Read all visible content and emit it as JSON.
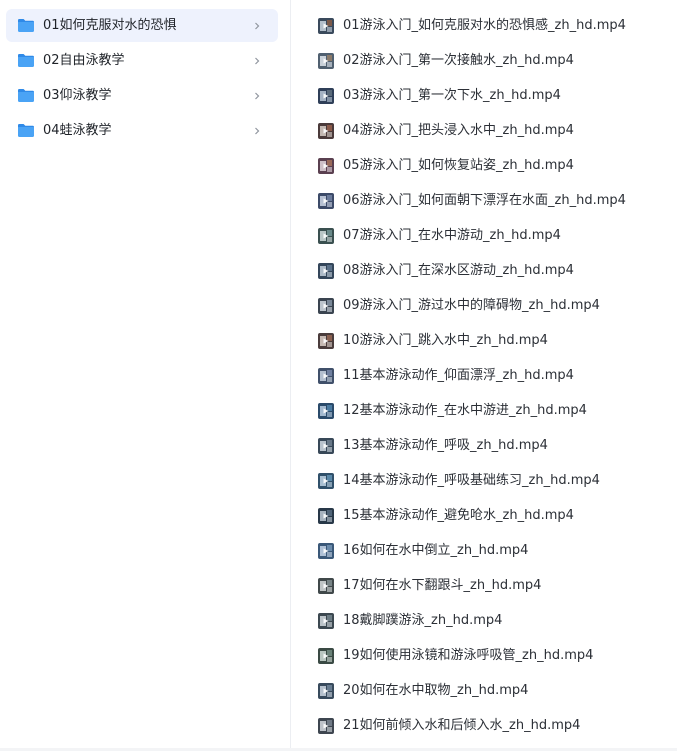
{
  "folders": [
    {
      "label": "01如何克服对水的恐惧",
      "icon": "folder-icon",
      "selected": true
    },
    {
      "label": "02自由泳教学",
      "icon": "folder-icon",
      "selected": false
    },
    {
      "label": "03仰泳教学",
      "icon": "folder-icon",
      "selected": false
    },
    {
      "label": "04蛙泳教学",
      "icon": "folder-icon",
      "selected": false
    }
  ],
  "files": [
    {
      "label": "01游泳入门_如何克服对水的恐惧感_zh_hd.mp4",
      "icon": "video-thumbnail-icon"
    },
    {
      "label": "02游泳入门_第一次接触水_zh_hd.mp4",
      "icon": "video-thumbnail-icon"
    },
    {
      "label": "03游泳入门_第一次下水_zh_hd.mp4",
      "icon": "video-thumbnail-icon"
    },
    {
      "label": "04游泳入门_把头浸入水中_zh_hd.mp4",
      "icon": "video-thumbnail-icon"
    },
    {
      "label": "05游泳入门_如何恢复站姿_zh_hd.mp4",
      "icon": "video-thumbnail-icon"
    },
    {
      "label": "06游泳入门_如何面朝下漂浮在水面_zh_hd.mp4",
      "icon": "video-thumbnail-icon"
    },
    {
      "label": "07游泳入门_在水中游动_zh_hd.mp4",
      "icon": "video-thumbnail-icon"
    },
    {
      "label": "08游泳入门_在深水区游动_zh_hd.mp4",
      "icon": "video-thumbnail-icon"
    },
    {
      "label": "09游泳入门_游过水中的障碍物_zh_hd.mp4",
      "icon": "video-thumbnail-icon"
    },
    {
      "label": "10游泳入门_跳入水中_zh_hd.mp4",
      "icon": "video-thumbnail-icon"
    },
    {
      "label": "11基本游泳动作_仰面漂浮_zh_hd.mp4",
      "icon": "video-thumbnail-icon"
    },
    {
      "label": "12基本游泳动作_在水中游进_zh_hd.mp4",
      "icon": "video-thumbnail-icon"
    },
    {
      "label": "13基本游泳动作_呼吸_zh_hd.mp4",
      "icon": "video-thumbnail-icon"
    },
    {
      "label": "14基本游泳动作_呼吸基础练习_zh_hd.mp4",
      "icon": "video-thumbnail-icon"
    },
    {
      "label": "15基本游泳动作_避免呛水_zh_hd.mp4",
      "icon": "video-thumbnail-icon"
    },
    {
      "label": "16如何在水中倒立_zh_hd.mp4",
      "icon": "video-thumbnail-icon"
    },
    {
      "label": "17如何在水下翻跟斗_zh_hd.mp4",
      "icon": "video-thumbnail-icon"
    },
    {
      "label": "18戴脚蹼游泳_zh_hd.mp4",
      "icon": "video-thumbnail-icon"
    },
    {
      "label": "19如何使用泳镜和游泳呼吸管_zh_hd.mp4",
      "icon": "video-thumbnail-icon"
    },
    {
      "label": "20如何在水中取物_zh_hd.mp4",
      "icon": "video-thumbnail-icon"
    },
    {
      "label": "21如何前倾入水和后倾入水_zh_hd.mp4",
      "icon": "video-thumbnail-icon"
    }
  ],
  "colors": {
    "folder": "#4aa3f5",
    "folder_tab": "#2f8ae8",
    "selected_bg": "#eef2fd",
    "chevron": "#8f959e"
  }
}
